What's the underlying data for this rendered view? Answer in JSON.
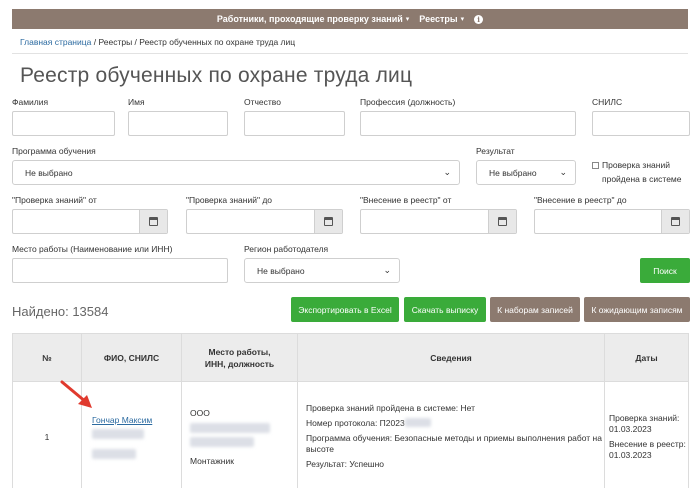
{
  "nav": {
    "items": [
      {
        "label": "Работники, проходящие проверку знаний"
      },
      {
        "label": "Реестры"
      }
    ],
    "info_icon": "info-circle-icon"
  },
  "breadcrumb": {
    "home": "Главная страница",
    "sep1": " / ",
    "registries": "Реестры",
    "sep2": " / ",
    "current": "Реестр обученных по охране труда лиц"
  },
  "title": "Реестр обученных по охране труда лиц",
  "filters": {
    "surname": "Фамилия",
    "name": "Имя",
    "patronymic": "Отчество",
    "profession": "Профессия (должность)",
    "snils": "СНИЛС",
    "program": "Программа обучения",
    "program_value": "Не выбрано",
    "result": "Результат",
    "result_value": "Не выбрано",
    "check_in_system": "Проверка знаний пройдена в системе",
    "check_from": "\"Проверка знаний\" от",
    "check_to": "\"Проверка знаний\" до",
    "reg_from": "\"Внесение в реестр\" от",
    "reg_to": "\"Внесение в реестр\" до",
    "workplace": "Место работы (Наименование или ИНН)",
    "region": "Регион работодателя",
    "region_value": "Не выбрано"
  },
  "buttons": {
    "search": "Поиск",
    "export": "Экспортировать в Excel",
    "download": "Скачать выписку",
    "to_sets": "К наборам записей",
    "to_pending": "К ожидающим записям"
  },
  "found": "Найдено: 13584",
  "table": {
    "headers": [
      "№",
      "ФИО, СНИЛС",
      "Место работы, ИНН, должность",
      "Сведения",
      "Даты"
    ],
    "rows": [
      {
        "num": "1",
        "name": "Гончар Максим",
        "org": "ООО",
        "position": "Монтажник",
        "info": [
          "Проверка знаний пройдена в системе: Нет",
          "Номер протокола: П2023",
          "Программа обучения: Безопасные методы и приемы выполнения работ на высоте",
          "Результат: Успешно"
        ],
        "dates": [
          "Проверка знаний:",
          "01.03.2023",
          "Внесение в реестр:",
          "01.03.2023"
        ]
      }
    ]
  },
  "colors": {
    "brown": "#8c7a6f",
    "green": "#3aab3a",
    "link": "#2b6aa0",
    "arrow": "#e03a2e"
  }
}
